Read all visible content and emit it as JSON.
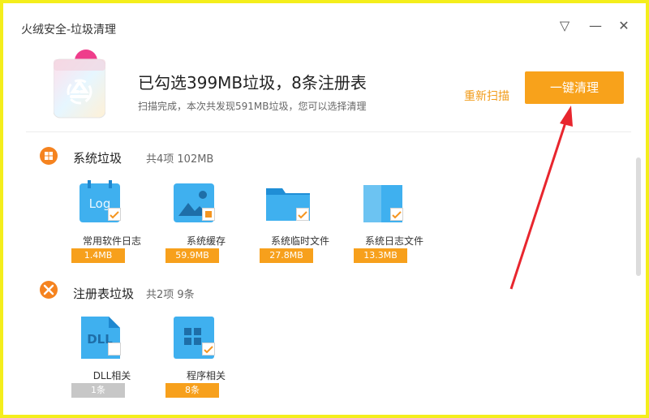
{
  "window": {
    "title": "火绒安全-垃圾清理"
  },
  "controls": {
    "menu_icon": "▽",
    "minimize_icon": "—",
    "close_icon": "✕"
  },
  "header": {
    "headline": "已勾选399MB垃圾，8条注册表",
    "subline": "扫描完成，本次共发现591MB垃圾，您可以选择清理",
    "rescan_label": "重新扫描",
    "clean_label": "一键清理"
  },
  "sections": [
    {
      "title": "系统垃圾",
      "summary": "共4项 102MB",
      "items": [
        {
          "name": "常用软件日志",
          "size": "1.4MB",
          "checked": true
        },
        {
          "name": "系统缓存",
          "size": "59.9MB",
          "checked": "partial"
        },
        {
          "name": "系统临时文件",
          "size": "27.8MB",
          "checked": true
        },
        {
          "name": "系统日志文件",
          "size": "13.3MB",
          "checked": true
        }
      ]
    },
    {
      "title": "注册表垃圾",
      "summary": "共2项 9条",
      "items": [
        {
          "name": "DLL相关",
          "size": "1条",
          "checked": false
        },
        {
          "name": "程序相关",
          "size": "8条",
          "checked": true
        }
      ]
    }
  ],
  "icons": {
    "log": "Log",
    "dll": "DLL"
  },
  "colors": {
    "accent": "#f8a21b",
    "blue": "#3fb0ef",
    "border": "#f4ee1c",
    "arrow": "#e8262e"
  }
}
